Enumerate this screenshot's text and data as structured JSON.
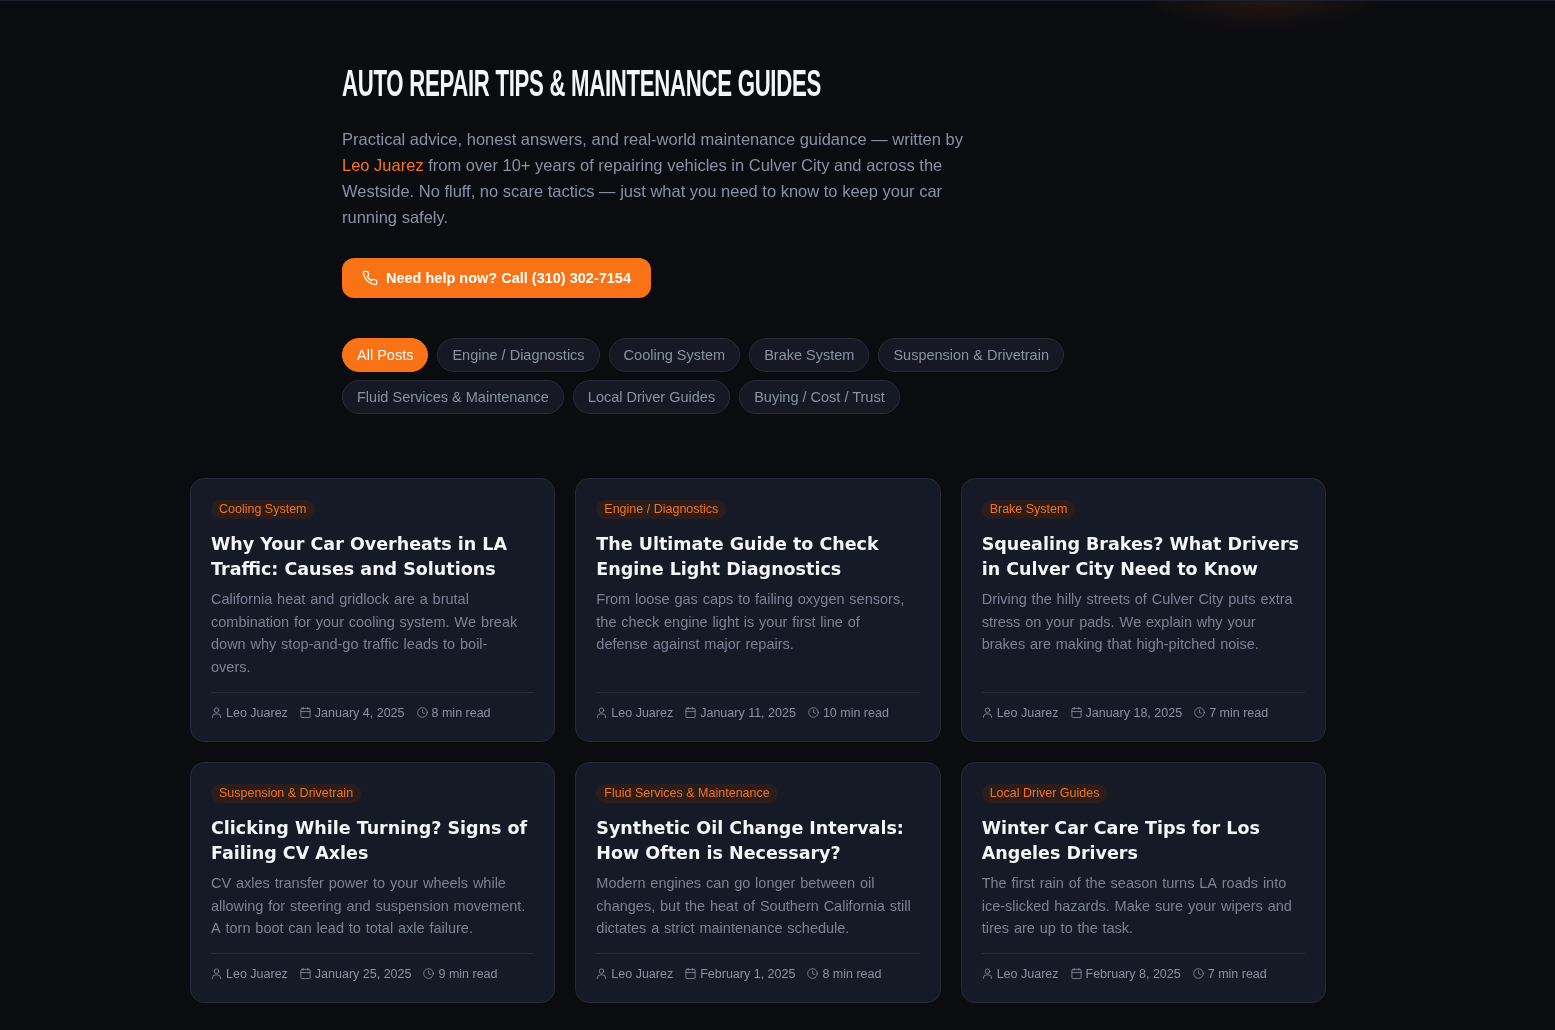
{
  "header": {
    "title": "AUTO REPAIR TIPS & MAINTENANCE GUIDES",
    "intro": {
      "before": "Practical advice, honest answers, and real-world maintenance guidance — written by",
      "author_link": "Leo Juarez",
      "after": "from over 10+ years of repairing vehicles in Culver City and across the Westside. No fluff, no scare tactics — just what you need to know to keep your car running safely."
    },
    "call_button": "Need help now? Call (310) 302-7154"
  },
  "filters": [
    {
      "label": "All Posts",
      "selected": true
    },
    {
      "label": "Engine / Diagnostics",
      "selected": false
    },
    {
      "label": "Cooling System",
      "selected": false
    },
    {
      "label": "Brake System",
      "selected": false
    },
    {
      "label": "Suspension & Drivetrain",
      "selected": false
    },
    {
      "label": "Fluid Services & Maintenance",
      "selected": false
    },
    {
      "label": "Local Driver Guides",
      "selected": false
    },
    {
      "label": "Buying / Cost / Trust",
      "selected": false
    }
  ],
  "posts": [
    {
      "category": "Cooling System",
      "title": "Why Your Car Overheats in LA Traffic: Causes and Solutions",
      "excerpt": "California heat and gridlock are a brutal combination for your cooling system. We break down why stop-and-go traffic leads to boil-overs.",
      "author": "Leo Juarez",
      "date": "January 4, 2025",
      "read_time": "8 min read"
    },
    {
      "category": "Engine / Diagnostics",
      "title": "The Ultimate Guide to Check Engine Light Diagnostics",
      "excerpt": "From loose gas caps to failing oxygen sensors, the check engine light is your first line of defense against major repairs.",
      "author": "Leo Juarez",
      "date": "January 11, 2025",
      "read_time": "10 min read"
    },
    {
      "category": "Brake System",
      "title": "Squealing Brakes? What Drivers in Culver City Need to Know",
      "excerpt": "Driving the hilly streets of Culver City puts extra stress on your pads. We explain why your brakes are making that high-pitched noise.",
      "author": "Leo Juarez",
      "date": "January 18, 2025",
      "read_time": "7 min read"
    },
    {
      "category": "Suspension & Drivetrain",
      "title": "Clicking While Turning? Signs of Failing CV Axles",
      "excerpt": "CV axles transfer power to your wheels while allowing for steering and suspension movement. A torn boot can lead to total axle failure.",
      "author": "Leo Juarez",
      "date": "January 25, 2025",
      "read_time": "9 min read"
    },
    {
      "category": "Fluid Services & Maintenance",
      "title": "Synthetic Oil Change Intervals: How Often is Necessary?",
      "excerpt": "Modern engines can go longer between oil changes, but the heat of Southern California still dictates a strict maintenance schedule.",
      "author": "Leo Juarez",
      "date": "February 1, 2025",
      "read_time": "8 min read"
    },
    {
      "category": "Local Driver Guides",
      "title": "Winter Car Care Tips for Los Angeles Drivers",
      "excerpt": "The first rain of the season turns LA roads into ice-slicked hazards. Make sure your wipers and tires are up to the task.",
      "author": "Leo Juarez",
      "date": "February 8, 2025",
      "read_time": "7 min read"
    }
  ]
}
